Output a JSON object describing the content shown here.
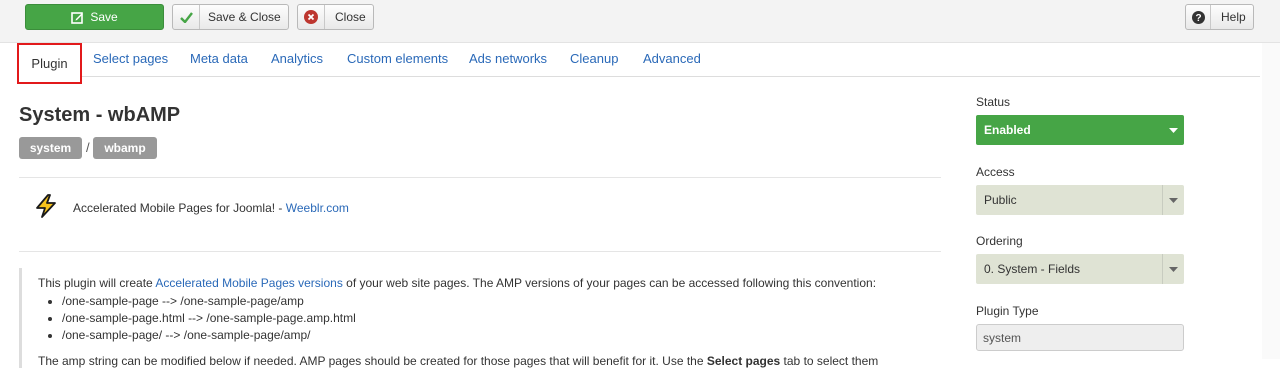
{
  "toolbar": {
    "save_label": "Save",
    "save_close_label": "Save & Close",
    "close_label": "Close",
    "help_label": "Help"
  },
  "tabs": [
    {
      "label": "Plugin"
    },
    {
      "label": "Select pages"
    },
    {
      "label": "Meta data"
    },
    {
      "label": "Analytics"
    },
    {
      "label": "Custom elements"
    },
    {
      "label": "Ads networks"
    },
    {
      "label": "Cleanup"
    },
    {
      "label": "Advanced"
    }
  ],
  "main": {
    "title": "System - wbAMP",
    "badges": [
      "system",
      "wbamp"
    ],
    "badge_separator": "/",
    "description_prefix": "Accelerated Mobile Pages for Joomla! - ",
    "description_link": "Weeblr.com",
    "info": {
      "intro_prefix": "This plugin will create ",
      "intro_link": "Accelerated Mobile Pages versions",
      "intro_suffix": " of your web site pages. The AMP versions of your pages can be accessed following this convention:",
      "examples": [
        "/one-sample-page --> /one-sample-page/amp",
        "/one-sample-page.html --> /one-sample-page.amp.html",
        "/one-sample-page/ --> /one-sample-page/amp/"
      ],
      "more_prefix": "The amp string can be modified below if needed. AMP pages should be created for those pages that will benefit for it. Use the ",
      "more_bold": "Select pages",
      "more_suffix": " tab to select them"
    }
  },
  "sidebar": {
    "status_label": "Status",
    "status_value": "Enabled",
    "access_label": "Access",
    "access_value": "Public",
    "ordering_label": "Ordering",
    "ordering_value": "0. System - Fields",
    "plugin_type_label": "Plugin Type",
    "plugin_type_value": "system"
  },
  "colors": {
    "success": "#46a546",
    "link": "#2a69b8",
    "highlight": "#e2191b"
  }
}
